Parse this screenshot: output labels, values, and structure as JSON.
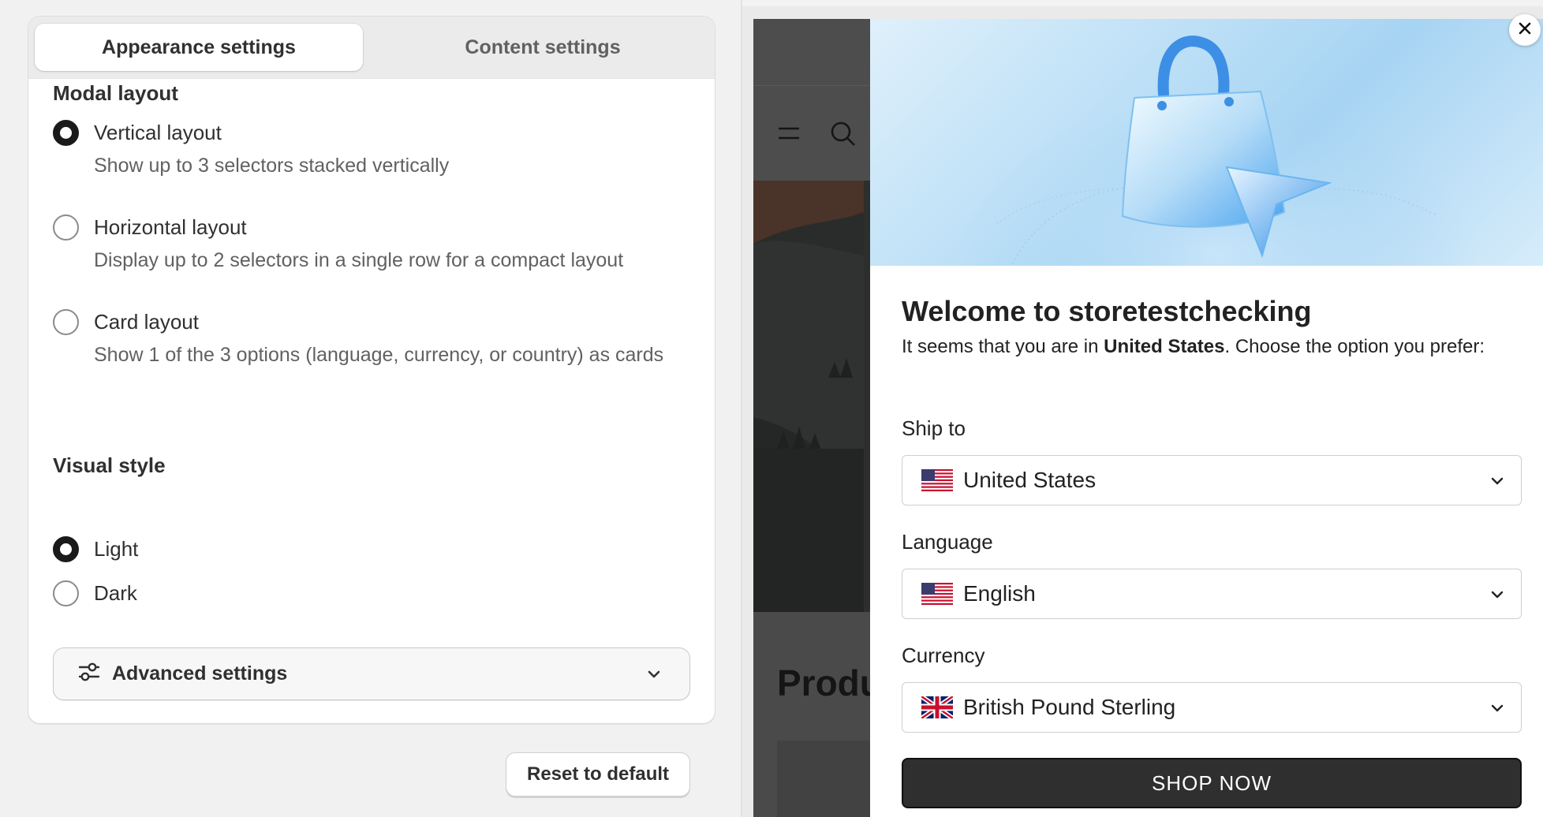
{
  "tabs": [
    {
      "label": "Appearance settings",
      "active": true
    },
    {
      "label": "Content settings",
      "active": false
    }
  ],
  "modal_layout": {
    "title": "Modal layout",
    "options": [
      {
        "label": "Vertical layout",
        "description": "Show up to 3 selectors stacked vertically",
        "checked": true
      },
      {
        "label": "Horizontal layout",
        "description": "Display up to 2 selectors in a single row for a compact layout",
        "checked": false
      },
      {
        "label": "Card layout",
        "description": "Show 1 of the 3 options (language, currency, or country) as cards",
        "checked": false
      }
    ]
  },
  "visual_style": {
    "title": "Visual style",
    "options": [
      {
        "label": "Light",
        "checked": true
      },
      {
        "label": "Dark",
        "checked": false
      }
    ]
  },
  "advanced": {
    "label": "Advanced settings",
    "icon": "sliders-icon"
  },
  "reset_label": "Reset to default",
  "preview": {
    "store_heading": "Produ",
    "modal": {
      "title": "Welcome to storetestchecking",
      "subtext_prefix": "It seems that you are in ",
      "country": "United States",
      "subtext_suffix": ". Choose the option you prefer:",
      "ship_to": {
        "label": "Ship to",
        "value": "United States",
        "flag": "us-flag-icon"
      },
      "language": {
        "label": "Language",
        "value": "English",
        "flag": "us-flag-icon"
      },
      "currency": {
        "label": "Currency",
        "value": "British Pound Sterling",
        "flag": "uk-flag-icon"
      },
      "button_label": "SHOP NOW"
    }
  },
  "colors": {
    "primary_dark": "#1a1a1a",
    "button_bg": "#2f2f2f",
    "panel_bg": "#f1f1f1",
    "banner_blue": "#a7d4f3"
  }
}
